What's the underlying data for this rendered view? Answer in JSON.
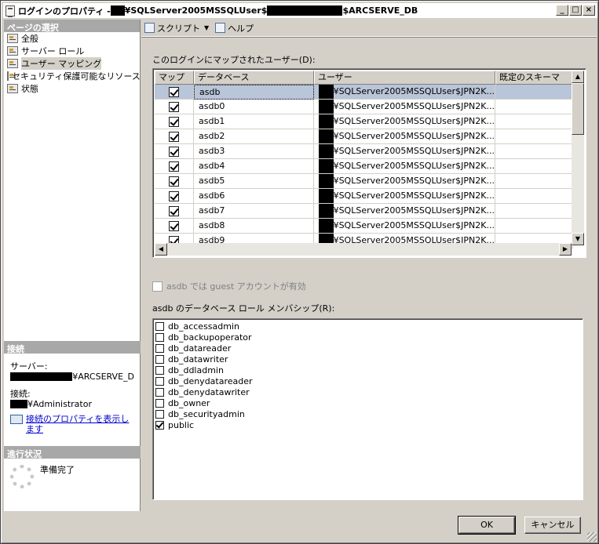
{
  "window": {
    "title_prefix": "ログインのプロパティ - ",
    "title_mid": "¥SQLServer2005MSSQLUser$",
    "title_suffix": "$ARCSERVE_DB",
    "min_label": "_",
    "max_label": "□",
    "close_label": "×"
  },
  "sidebar": {
    "header": "ページの選択",
    "items": [
      {
        "label": "全般"
      },
      {
        "label": "サーバー ロール"
      },
      {
        "label": "ユーザー マッピング"
      },
      {
        "label": "セキュリティ保護可能なリソース"
      },
      {
        "label": "状態"
      }
    ]
  },
  "connection": {
    "header": "接続",
    "server_label": "サーバー:",
    "server_value": "¥ARCSERVE_D",
    "conn_label": "接続:",
    "conn_value": "¥Administrator",
    "link": "接続のプロパティを表示します"
  },
  "progress": {
    "header": "進行状況",
    "status": "準備完了"
  },
  "toolbar": {
    "script": "スクリプト",
    "help": "ヘルプ"
  },
  "mapping": {
    "caption": "このログインにマップされたユーザー(D):",
    "columns": [
      "マップ",
      "データベース",
      "ユーザー",
      "既定のスキーマ"
    ],
    "rows": [
      {
        "map": true,
        "db": "asdb",
        "user": "¥SQLServer2005MSSQLUser$JPN2K...",
        "schema": ""
      },
      {
        "map": true,
        "db": "asdb0",
        "user": "¥SQLServer2005MSSQLUser$JPN2K...",
        "schema": ""
      },
      {
        "map": true,
        "db": "asdb1",
        "user": "¥SQLServer2005MSSQLUser$JPN2K...",
        "schema": ""
      },
      {
        "map": true,
        "db": "asdb2",
        "user": "¥SQLServer2005MSSQLUser$JPN2K...",
        "schema": ""
      },
      {
        "map": true,
        "db": "asdb3",
        "user": "¥SQLServer2005MSSQLUser$JPN2K...",
        "schema": ""
      },
      {
        "map": true,
        "db": "asdb4",
        "user": "¥SQLServer2005MSSQLUser$JPN2K...",
        "schema": ""
      },
      {
        "map": true,
        "db": "asdb5",
        "user": "¥SQLServer2005MSSQLUser$JPN2K...",
        "schema": ""
      },
      {
        "map": true,
        "db": "asdb6",
        "user": "¥SQLServer2005MSSQLUser$JPN2K...",
        "schema": ""
      },
      {
        "map": true,
        "db": "asdb7",
        "user": "¥SQLServer2005MSSQLUser$JPN2K...",
        "schema": ""
      },
      {
        "map": true,
        "db": "asdb8",
        "user": "¥SQLServer2005MSSQLUser$JPN2K...",
        "schema": ""
      },
      {
        "map": true,
        "db": "asdb9",
        "user": "¥SQLServer2005MSSQLUser$JPN2K...",
        "schema": ""
      }
    ]
  },
  "guest": {
    "label": "asdb では guest アカウントが有効",
    "checked": false
  },
  "roles": {
    "caption": "asdb のデータベース ロール メンバシップ(R):",
    "items": [
      {
        "name": "db_accessadmin",
        "checked": false
      },
      {
        "name": "db_backupoperator",
        "checked": false
      },
      {
        "name": "db_datareader",
        "checked": false
      },
      {
        "name": "db_datawriter",
        "checked": false
      },
      {
        "name": "db_ddladmin",
        "checked": false
      },
      {
        "name": "db_denydatareader",
        "checked": false
      },
      {
        "name": "db_denydatawriter",
        "checked": false
      },
      {
        "name": "db_owner",
        "checked": false
      },
      {
        "name": "db_securityadmin",
        "checked": false
      },
      {
        "name": "public",
        "checked": true
      }
    ]
  },
  "buttons": {
    "ok": "OK",
    "cancel": "キャンセル"
  },
  "colors": {
    "selected_row": "#b9c5d8",
    "section_header": "#a8a8a8",
    "dialog_face": "#d4d0c8"
  }
}
